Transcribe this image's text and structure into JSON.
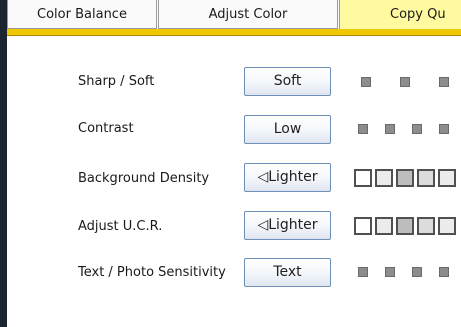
{
  "tabs": [
    {
      "label": "Color Balance"
    },
    {
      "label": "Adjust Color"
    },
    {
      "label": "Copy Qu"
    }
  ],
  "rows": [
    {
      "label": "Sharp / Soft",
      "value": "Soft"
    },
    {
      "label": "Contrast",
      "value": "Low"
    },
    {
      "label": "Background Density",
      "value": "◁Lighter"
    },
    {
      "label": "Adjust U.C.R.",
      "value": "◁Lighter"
    },
    {
      "label": "Text / Photo Sensitivity",
      "value": "Text"
    }
  ],
  "colors": {
    "active_tab": "#fff9a0",
    "tab_underline": "#f0c800",
    "button_border": "#6f8fb8",
    "level_square": "#8d8d8d"
  }
}
